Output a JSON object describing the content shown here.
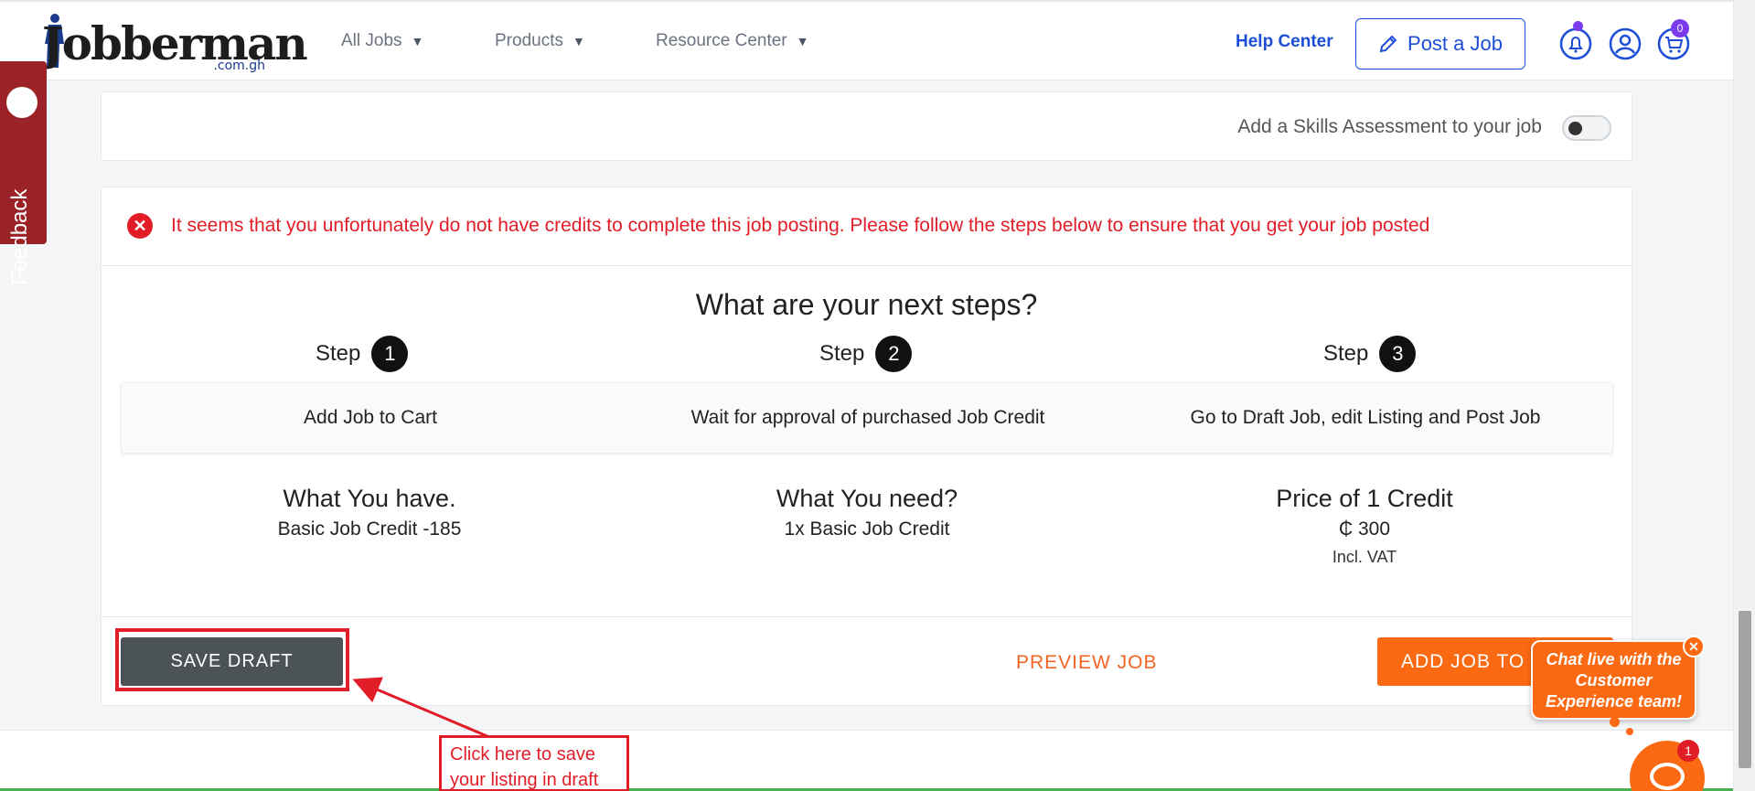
{
  "nav": {
    "logo_text": "Jobberman",
    "logo_sub": ".com.gh",
    "menu": [
      {
        "label": "All Jobs"
      },
      {
        "label": "Products"
      },
      {
        "label": "Resource Center"
      }
    ],
    "help_center": "Help Center",
    "post_job": "Post a Job",
    "cart_count": "0"
  },
  "feedback": {
    "label": "Feedback"
  },
  "skills": {
    "label": "Add a Skills Assessment to your job",
    "enabled": false
  },
  "alert": {
    "icon": "close-circle-icon",
    "message": "It seems that you unfortunately do not have credits to complete this job posting. Please follow the steps below to ensure that you get your job posted"
  },
  "next_steps": {
    "title": "What are your next steps?",
    "step_word": "Step",
    "steps": [
      {
        "number": "1",
        "text": "Add Job to Cart"
      },
      {
        "number": "2",
        "text": "Wait for approval of purchased Job Credit"
      },
      {
        "number": "3",
        "text": "Go to Draft Job, edit Listing and Post Job"
      }
    ]
  },
  "credits": {
    "have_title": "What You have.",
    "have_value": "Basic Job Credit -185",
    "need_title": "What You need?",
    "need_value": "1x Basic Job Credit",
    "price_title": "Price of 1 Credit",
    "price_value": "₵ 300",
    "price_note": "Incl. VAT"
  },
  "actions": {
    "save_draft": "SAVE DRAFT",
    "preview": "PREVIEW JOB",
    "add_to_cart": "ADD JOB TO"
  },
  "annotation": {
    "text": "Click here to save your listing in draft"
  },
  "chat": {
    "bubble": "Chat live with the Customer Experience team!",
    "close": "✕",
    "unread": "1"
  },
  "colors": {
    "brand_blue": "#1d4ed8",
    "accent_orange": "#fb6a12",
    "error_red": "#e11d28",
    "feedback_red": "#9b2226",
    "badge_purple": "#7c3aed"
  }
}
